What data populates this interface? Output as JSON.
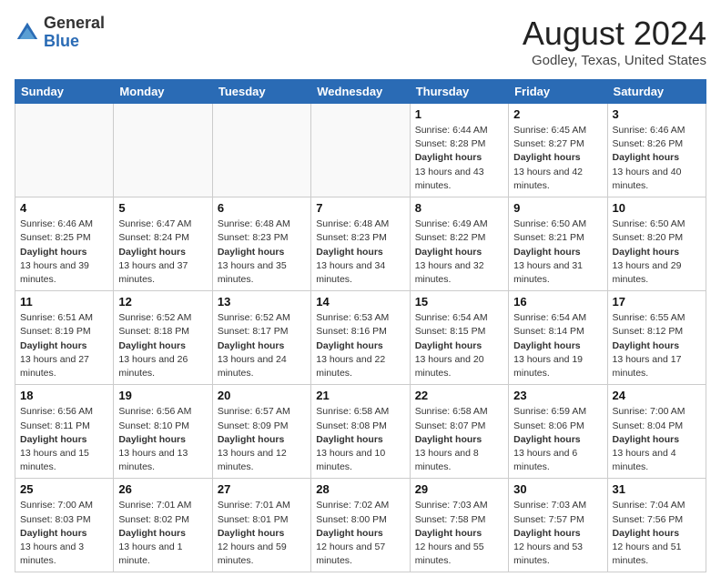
{
  "header": {
    "logo_line1": "General",
    "logo_line2": "Blue",
    "month_title": "August 2024",
    "location": "Godley, Texas, United States"
  },
  "days_of_week": [
    "Sunday",
    "Monday",
    "Tuesday",
    "Wednesday",
    "Thursday",
    "Friday",
    "Saturday"
  ],
  "weeks": [
    [
      {
        "num": "",
        "sunrise": "",
        "sunset": "",
        "daylight": ""
      },
      {
        "num": "",
        "sunrise": "",
        "sunset": "",
        "daylight": ""
      },
      {
        "num": "",
        "sunrise": "",
        "sunset": "",
        "daylight": ""
      },
      {
        "num": "",
        "sunrise": "",
        "sunset": "",
        "daylight": ""
      },
      {
        "num": "1",
        "sunrise": "Sunrise: 6:44 AM",
        "sunset": "Sunset: 8:28 PM",
        "daylight": "Daylight: 13 hours and 43 minutes."
      },
      {
        "num": "2",
        "sunrise": "Sunrise: 6:45 AM",
        "sunset": "Sunset: 8:27 PM",
        "daylight": "Daylight: 13 hours and 42 minutes."
      },
      {
        "num": "3",
        "sunrise": "Sunrise: 6:46 AM",
        "sunset": "Sunset: 8:26 PM",
        "daylight": "Daylight: 13 hours and 40 minutes."
      }
    ],
    [
      {
        "num": "4",
        "sunrise": "Sunrise: 6:46 AM",
        "sunset": "Sunset: 8:25 PM",
        "daylight": "Daylight: 13 hours and 39 minutes."
      },
      {
        "num": "5",
        "sunrise": "Sunrise: 6:47 AM",
        "sunset": "Sunset: 8:24 PM",
        "daylight": "Daylight: 13 hours and 37 minutes."
      },
      {
        "num": "6",
        "sunrise": "Sunrise: 6:48 AM",
        "sunset": "Sunset: 8:23 PM",
        "daylight": "Daylight: 13 hours and 35 minutes."
      },
      {
        "num": "7",
        "sunrise": "Sunrise: 6:48 AM",
        "sunset": "Sunset: 8:23 PM",
        "daylight": "Daylight: 13 hours and 34 minutes."
      },
      {
        "num": "8",
        "sunrise": "Sunrise: 6:49 AM",
        "sunset": "Sunset: 8:22 PM",
        "daylight": "Daylight: 13 hours and 32 minutes."
      },
      {
        "num": "9",
        "sunrise": "Sunrise: 6:50 AM",
        "sunset": "Sunset: 8:21 PM",
        "daylight": "Daylight: 13 hours and 31 minutes."
      },
      {
        "num": "10",
        "sunrise": "Sunrise: 6:50 AM",
        "sunset": "Sunset: 8:20 PM",
        "daylight": "Daylight: 13 hours and 29 minutes."
      }
    ],
    [
      {
        "num": "11",
        "sunrise": "Sunrise: 6:51 AM",
        "sunset": "Sunset: 8:19 PM",
        "daylight": "Daylight: 13 hours and 27 minutes."
      },
      {
        "num": "12",
        "sunrise": "Sunrise: 6:52 AM",
        "sunset": "Sunset: 8:18 PM",
        "daylight": "Daylight: 13 hours and 26 minutes."
      },
      {
        "num": "13",
        "sunrise": "Sunrise: 6:52 AM",
        "sunset": "Sunset: 8:17 PM",
        "daylight": "Daylight: 13 hours and 24 minutes."
      },
      {
        "num": "14",
        "sunrise": "Sunrise: 6:53 AM",
        "sunset": "Sunset: 8:16 PM",
        "daylight": "Daylight: 13 hours and 22 minutes."
      },
      {
        "num": "15",
        "sunrise": "Sunrise: 6:54 AM",
        "sunset": "Sunset: 8:15 PM",
        "daylight": "Daylight: 13 hours and 20 minutes."
      },
      {
        "num": "16",
        "sunrise": "Sunrise: 6:54 AM",
        "sunset": "Sunset: 8:14 PM",
        "daylight": "Daylight: 13 hours and 19 minutes."
      },
      {
        "num": "17",
        "sunrise": "Sunrise: 6:55 AM",
        "sunset": "Sunset: 8:12 PM",
        "daylight": "Daylight: 13 hours and 17 minutes."
      }
    ],
    [
      {
        "num": "18",
        "sunrise": "Sunrise: 6:56 AM",
        "sunset": "Sunset: 8:11 PM",
        "daylight": "Daylight: 13 hours and 15 minutes."
      },
      {
        "num": "19",
        "sunrise": "Sunrise: 6:56 AM",
        "sunset": "Sunset: 8:10 PM",
        "daylight": "Daylight: 13 hours and 13 minutes."
      },
      {
        "num": "20",
        "sunrise": "Sunrise: 6:57 AM",
        "sunset": "Sunset: 8:09 PM",
        "daylight": "Daylight: 13 hours and 12 minutes."
      },
      {
        "num": "21",
        "sunrise": "Sunrise: 6:58 AM",
        "sunset": "Sunset: 8:08 PM",
        "daylight": "Daylight: 13 hours and 10 minutes."
      },
      {
        "num": "22",
        "sunrise": "Sunrise: 6:58 AM",
        "sunset": "Sunset: 8:07 PM",
        "daylight": "Daylight: 13 hours and 8 minutes."
      },
      {
        "num": "23",
        "sunrise": "Sunrise: 6:59 AM",
        "sunset": "Sunset: 8:06 PM",
        "daylight": "Daylight: 13 hours and 6 minutes."
      },
      {
        "num": "24",
        "sunrise": "Sunrise: 7:00 AM",
        "sunset": "Sunset: 8:04 PM",
        "daylight": "Daylight: 13 hours and 4 minutes."
      }
    ],
    [
      {
        "num": "25",
        "sunrise": "Sunrise: 7:00 AM",
        "sunset": "Sunset: 8:03 PM",
        "daylight": "Daylight: 13 hours and 3 minutes."
      },
      {
        "num": "26",
        "sunrise": "Sunrise: 7:01 AM",
        "sunset": "Sunset: 8:02 PM",
        "daylight": "Daylight: 13 hours and 1 minute."
      },
      {
        "num": "27",
        "sunrise": "Sunrise: 7:01 AM",
        "sunset": "Sunset: 8:01 PM",
        "daylight": "Daylight: 12 hours and 59 minutes."
      },
      {
        "num": "28",
        "sunrise": "Sunrise: 7:02 AM",
        "sunset": "Sunset: 8:00 PM",
        "daylight": "Daylight: 12 hours and 57 minutes."
      },
      {
        "num": "29",
        "sunrise": "Sunrise: 7:03 AM",
        "sunset": "Sunset: 7:58 PM",
        "daylight": "Daylight: 12 hours and 55 minutes."
      },
      {
        "num": "30",
        "sunrise": "Sunrise: 7:03 AM",
        "sunset": "Sunset: 7:57 PM",
        "daylight": "Daylight: 12 hours and 53 minutes."
      },
      {
        "num": "31",
        "sunrise": "Sunrise: 7:04 AM",
        "sunset": "Sunset: 7:56 PM",
        "daylight": "Daylight: 12 hours and 51 minutes."
      }
    ]
  ]
}
